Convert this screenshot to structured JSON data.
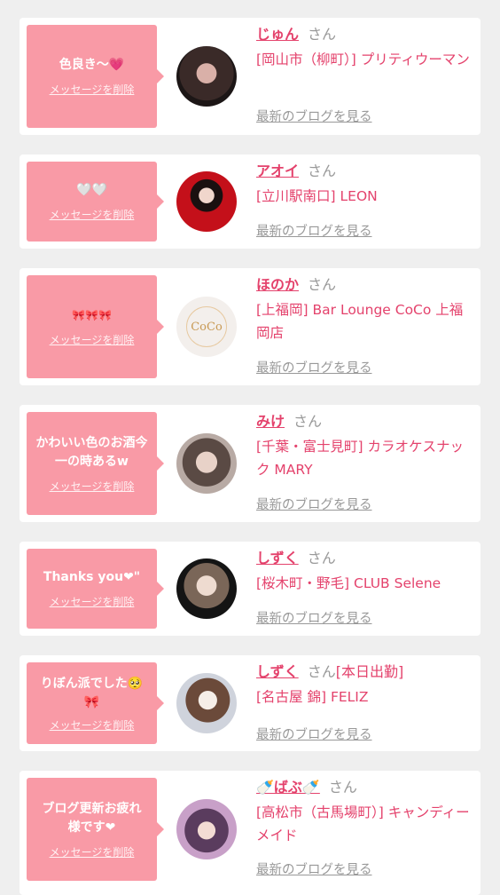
{
  "delete_label": "メッセージを削除",
  "san_label": "さん",
  "blog_label": "最新のブログを見る",
  "colors": {
    "accent": "#e4426c",
    "bubble": "#f99aa6",
    "background": "#efefef"
  },
  "cards": [
    {
      "message": "色良き〜💗",
      "name": "じゅん",
      "extra": "",
      "shop": "[岡山市（柳町）] プリティウーマン"
    },
    {
      "message": "🤍🤍",
      "name": "アオイ",
      "extra": "",
      "shop": "[立川駅南口] LEON"
    },
    {
      "message": "🎀🎀🎀",
      "name": "ほのか",
      "extra": "",
      "shop": "[上福岡] Bar Lounge CoCo 上福岡店",
      "avatar_text": "CoCo"
    },
    {
      "message": "かわいい色のお酒今一の時あるw",
      "name": "みけ",
      "extra": "",
      "shop": "[千葉・富士見町] カラオケスナック MARY"
    },
    {
      "message": "Thanks you❤\"",
      "name": "しずく",
      "extra": "",
      "shop": "[桜木町・野毛] CLUB Selene"
    },
    {
      "message": "りぼん派でした🥺🎀",
      "name": "しずく",
      "extra": "[本日出勤]",
      "shop": "[名古屋 錦] FELIZ"
    },
    {
      "message": "ブログ更新お疲れ様です❤",
      "name": "🍼ばぶ🍼",
      "extra": "",
      "shop": "[高松市（古馬場町）] キャンディーメイド"
    }
  ]
}
